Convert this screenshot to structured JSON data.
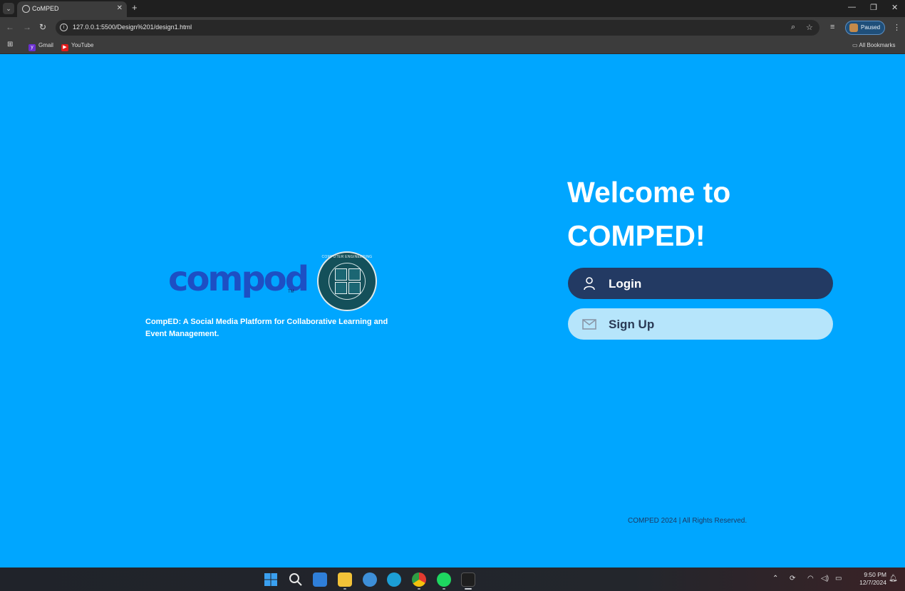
{
  "browser": {
    "tab_title": "CoMPED",
    "url": "127.0.0.1:5500/Design%201/design1.html",
    "profile_status": "Paused",
    "bookmarks": [
      {
        "label": "Gmail",
        "color": "#6b2fd0"
      },
      {
        "label": "YouTube",
        "color": "#e31b1b"
      }
    ],
    "all_bookmarks_label": "All Bookmarks"
  },
  "page": {
    "logo_text": "compod",
    "logo_tm": "TM",
    "seal_text": "COMPUTER ENGINEERING",
    "tagline": "CompED: A Social Media Platform for Collaborative Learning and Event Management.",
    "welcome_line1": "Welcome to",
    "welcome_line2": "COMPED!",
    "login_label": "Login",
    "signup_label": "Sign Up",
    "footer": "COMPED 2024 | All Rights Reserved.",
    "colors": {
      "background": "#00a6ff",
      "login_button": "#233a63",
      "signup_button": "#b6e5fb",
      "logo": "#1d4fc4"
    }
  },
  "taskbar": {
    "time": "9:50 PM",
    "date": "12/7/2024",
    "apps": [
      "start-icon",
      "search-icon",
      "store-icon",
      "file-explorer-icon",
      "help-icon",
      "edge-icon",
      "chrome-icon",
      "spotify-icon",
      "figma-icon"
    ]
  }
}
